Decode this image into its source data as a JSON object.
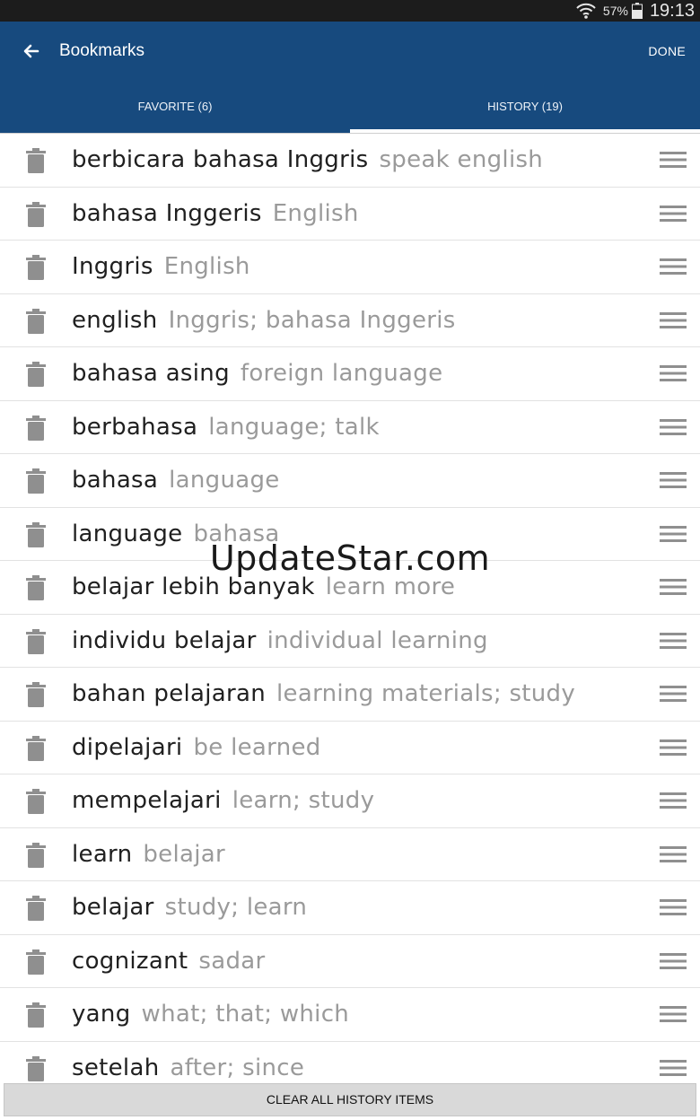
{
  "status": {
    "battery": "57%",
    "time": "19:13"
  },
  "appbar": {
    "title": "Bookmarks",
    "done_label": "DONE"
  },
  "tabs": [
    {
      "label": "FAVORITE (6)",
      "active": false
    },
    {
      "label": "HISTORY (19)",
      "active": true
    }
  ],
  "history": [
    {
      "word": "berbicara bahasa Inggris",
      "translation": "speak english"
    },
    {
      "word": "bahasa Inggeris",
      "translation": "English"
    },
    {
      "word": "Inggris",
      "translation": "English"
    },
    {
      "word": "english",
      "translation": "Inggris; bahasa Inggeris"
    },
    {
      "word": "bahasa asing",
      "translation": "foreign language"
    },
    {
      "word": "berbahasa",
      "translation": "language; talk"
    },
    {
      "word": "bahasa",
      "translation": "language"
    },
    {
      "word": "language",
      "translation": "bahasa"
    },
    {
      "word": "belajar lebih banyak",
      "translation": "learn more"
    },
    {
      "word": "individu belajar",
      "translation": "individual learning"
    },
    {
      "word": "bahan pelajaran",
      "translation": "learning materials; study"
    },
    {
      "word": "dipelajari",
      "translation": "be learned"
    },
    {
      "word": "mempelajari",
      "translation": "learn; study"
    },
    {
      "word": "learn",
      "translation": "belajar"
    },
    {
      "word": "belajar",
      "translation": "study; learn"
    },
    {
      "word": "cognizant",
      "translation": "sadar"
    },
    {
      "word": "yang",
      "translation": "what; that; which"
    },
    {
      "word": "setelah",
      "translation": "after; since"
    }
  ],
  "watermark": "UpdateStar.com",
  "clear_button_label": "CLEAR ALL HISTORY ITEMS",
  "colors": {
    "appbar": "#174a7e",
    "icon_gray": "#8f8f8f"
  },
  "icons": {
    "row_delete": "trash-icon",
    "row_reorder": "drag-handle-icon"
  }
}
